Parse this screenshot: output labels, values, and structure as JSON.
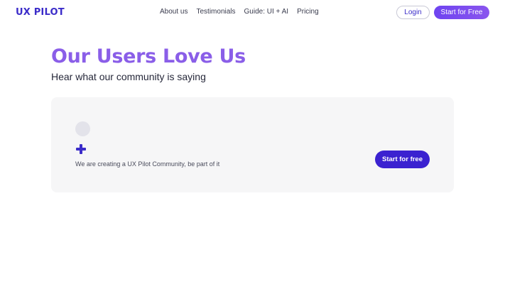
{
  "header": {
    "logo": "UX PILOT",
    "nav": [
      {
        "label": "About us"
      },
      {
        "label": "Testimonials"
      },
      {
        "label": "Guide: UI + AI"
      },
      {
        "label": "Pricing"
      }
    ],
    "login_label": "Login",
    "start_label": "Start for Free"
  },
  "hero": {
    "title": "Our Users Love Us",
    "subtitle": "Hear what our community is saying"
  },
  "card": {
    "avatar_icon": "avatar-placeholder",
    "plus_icon": "plus-icon",
    "text": "We are creating a UX Pilot Community, be part of it",
    "button_label": "Start for free"
  },
  "colors": {
    "brand": "#3b2cc9",
    "title": "#8a5ee8",
    "gradient_start": "#6e44f0",
    "gradient_end": "#8a55ee",
    "card_bg": "#f6f6f7",
    "card_button": "#3b22d0"
  }
}
